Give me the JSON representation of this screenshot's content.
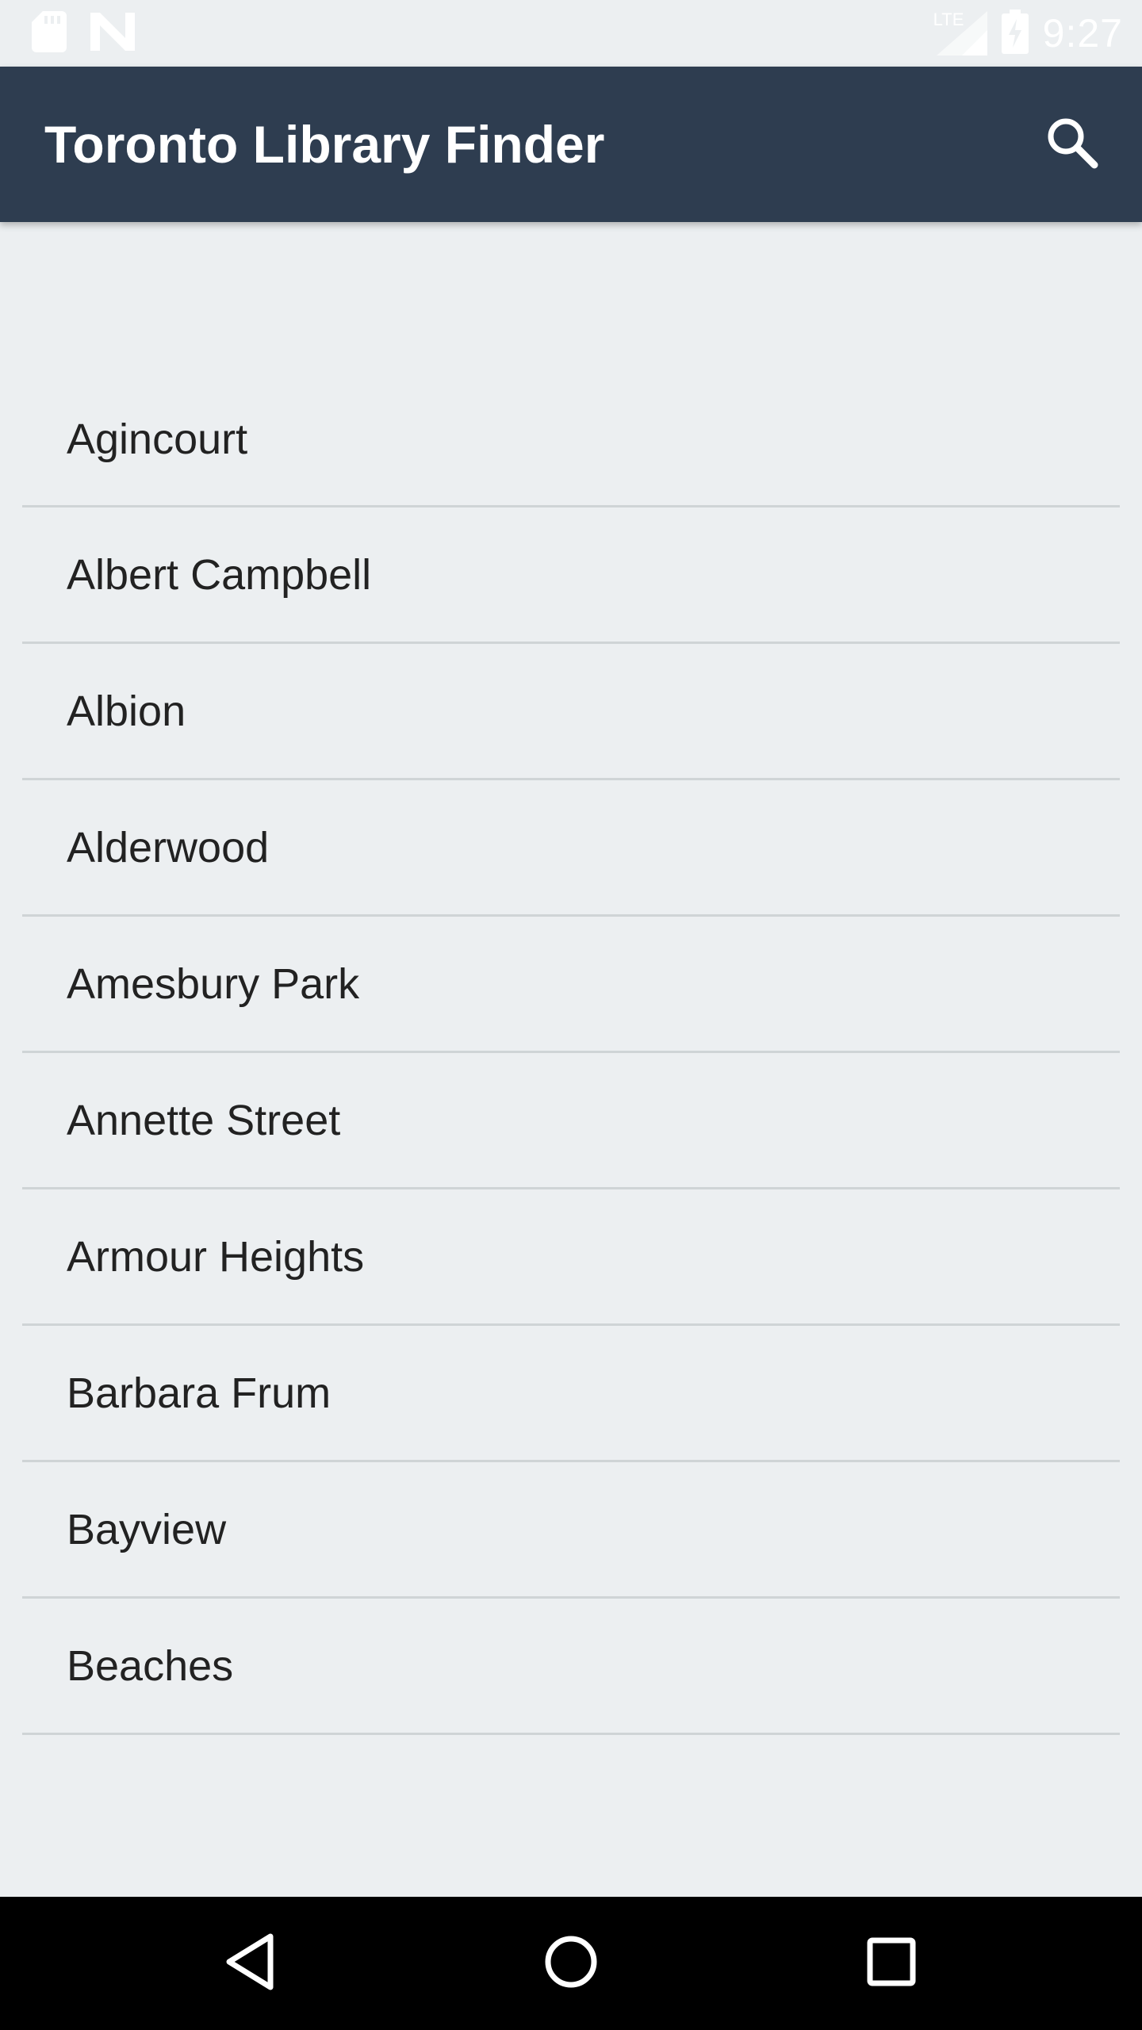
{
  "status_bar": {
    "time": "9:27",
    "network_label": "LTE",
    "left_icons": [
      "sd-card-icon",
      "n-notification-icon"
    ],
    "right_icons": [
      "signal-icon",
      "battery-charging-icon"
    ]
  },
  "app_bar": {
    "title": "Toronto Library Finder",
    "search_icon": "search-icon"
  },
  "libraries": [
    {
      "label": "Agincourt"
    },
    {
      "label": "Albert Campbell"
    },
    {
      "label": "Albion"
    },
    {
      "label": "Alderwood"
    },
    {
      "label": "Amesbury Park"
    },
    {
      "label": "Annette Street"
    },
    {
      "label": "Armour Heights"
    },
    {
      "label": "Barbara Frum"
    },
    {
      "label": "Bayview"
    },
    {
      "label": "Beaches"
    }
  ],
  "nav_bar": {
    "buttons": [
      "back-icon",
      "home-icon",
      "recents-icon"
    ]
  },
  "colors": {
    "app_bar": "#2E3D50",
    "background": "#ECEFF1",
    "divider": "#CFD4D6",
    "text": "#222222"
  }
}
